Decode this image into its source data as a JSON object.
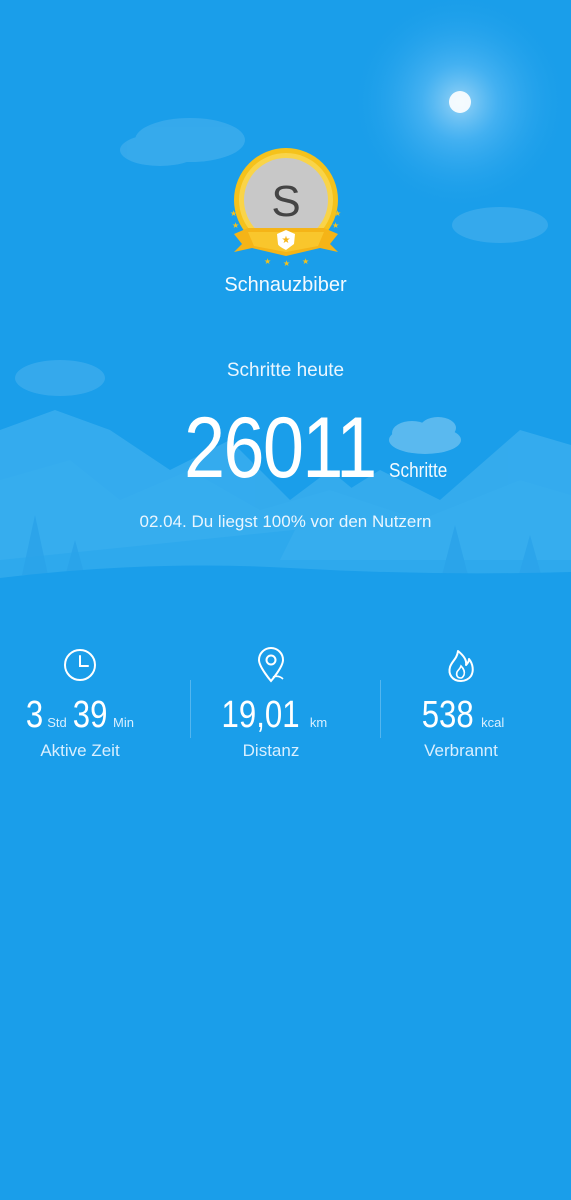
{
  "profile": {
    "avatar_letter": "S",
    "username": "Schnauzbiber"
  },
  "steps": {
    "label": "Schritte heute",
    "value": "26011",
    "unit": "Schritte",
    "comparison": "02.04. Du liegst 100% vor den Nutzern"
  },
  "stats": {
    "active_time": {
      "icon": "clock-icon",
      "hours": "3",
      "hours_unit": "Std",
      "minutes": "39",
      "minutes_unit": "Min",
      "label": "Aktive Zeit"
    },
    "distance": {
      "icon": "location-pin-icon",
      "value": "19,01",
      "unit": "km",
      "label": "Distanz"
    },
    "calories": {
      "icon": "flame-icon",
      "value": "538",
      "unit": "kcal",
      "label": "Verbrannt"
    }
  },
  "colors": {
    "background": "#1a9eea",
    "badge_gold": "#f5c21b",
    "avatar_gray": "#c8c8c8"
  }
}
